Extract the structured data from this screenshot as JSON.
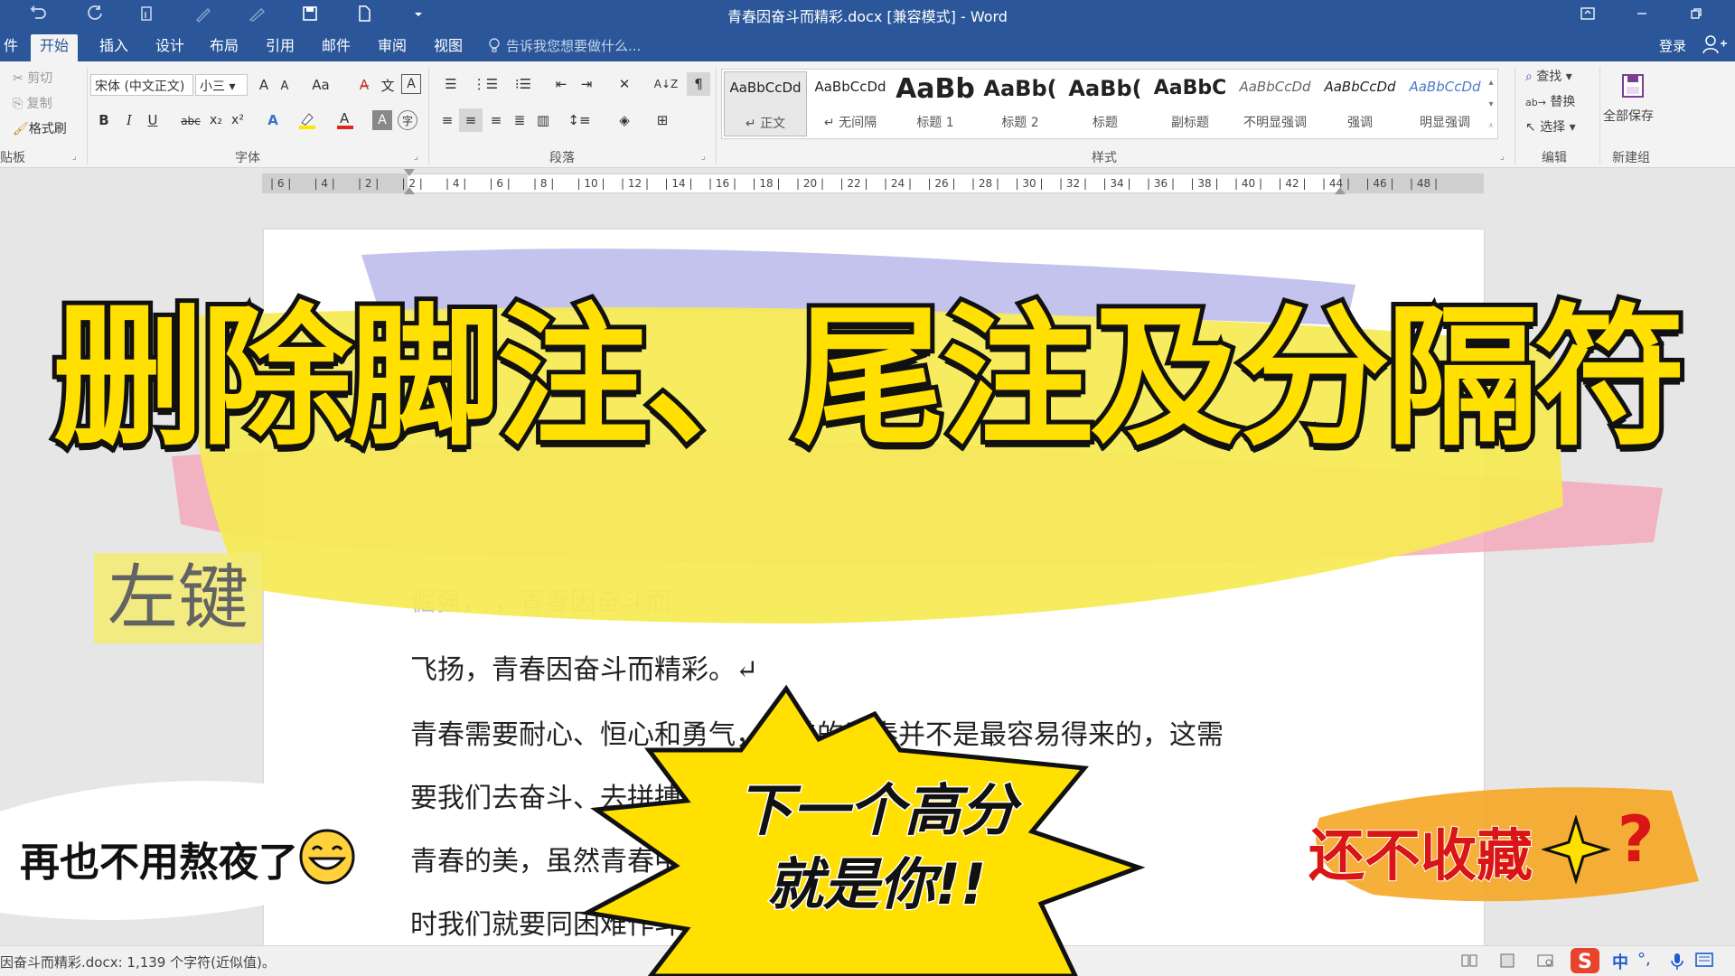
{
  "window": {
    "title": "青春因奋斗而精彩.docx [兼容模式] - Word"
  },
  "tabs": [
    {
      "label": "件"
    },
    {
      "label": "开始"
    },
    {
      "label": "插入"
    },
    {
      "label": "设计"
    },
    {
      "label": "布局"
    },
    {
      "label": "引用"
    },
    {
      "label": "邮件"
    },
    {
      "label": "审阅"
    },
    {
      "label": "视图"
    }
  ],
  "tell_me": "告诉我您想要做什么...",
  "account": {
    "login": "登录"
  },
  "ribbon": {
    "clipboard": {
      "cut": "剪切",
      "copy": "复制",
      "format_painter": "格式刷",
      "label": "贴板"
    },
    "font": {
      "family": "宋体 (中文正文)",
      "size": "小三",
      "grow": "A",
      "shrink": "A",
      "case": "Aa",
      "label": "字体",
      "bold": "B",
      "italic": "I",
      "underline": "U",
      "strike": "abc",
      "sub": "x₂",
      "sup": "x²"
    },
    "paragraph": {
      "label": "段落"
    },
    "styles": {
      "label": "样式",
      "items": [
        {
          "sample": "AaBbCcDd",
          "name": "↵ 正文"
        },
        {
          "sample": "AaBbCcDd",
          "name": "↵ 无间隔"
        },
        {
          "sample": "AaBb",
          "name": "标题 1"
        },
        {
          "sample": "AaBb(",
          "name": "标题 2"
        },
        {
          "sample": "AaBb(",
          "name": "标题"
        },
        {
          "sample": "AaBbC",
          "name": "副标题"
        },
        {
          "sample": "AaBbCcDd",
          "name": "不明显强调"
        },
        {
          "sample": "AaBbCcDd",
          "name": "强调"
        },
        {
          "sample": "AaBbCcDd",
          "name": "明显强调"
        }
      ]
    },
    "editing": {
      "find": "查找",
      "replace": "替换",
      "select": "选择",
      "label": "编辑"
    },
    "newgroup": {
      "save_all": "全部保存",
      "label": "新建组"
    }
  },
  "ruler": {
    "numbers": [
      "6",
      "4",
      "2",
      "2",
      "4",
      "6",
      "8",
      "10",
      "12",
      "14",
      "16",
      "18",
      "20",
      "22",
      "24",
      "26",
      "28",
      "30",
      "32",
      "34",
      "36",
      "38",
      "40",
      "42",
      "44",
      "46",
      "48"
    ]
  },
  "document": {
    "faded_line": "倔强，                                                  ，青春因奋斗而",
    "lines": [
      "飞扬，青春因奋斗而精彩。↵",
      "青春需要耐心、恒心和勇气，最美的青春并不是最容易得来的，这需",
      "要我们去奋斗、去拼搏，才能体会到青春的真正价值、",
      "青春的美，虽然青春中会有困难、更有退缩，",
      "时我们就要同困难作斗争，以青春已拼意志，去战胜"
    ]
  },
  "status": {
    "text": "因奋斗而精彩.docx: 1,139 个字符(近似值)。",
    "ime": "中"
  },
  "overlay": {
    "headline": "删除脚注、尾注及分隔符",
    "left_key": "左键",
    "burst_line1": "下一个高分",
    "burst_line2": "就是你!!",
    "never_again": "再也不用熬夜了",
    "collect": "还不收藏",
    "question": "?",
    "colors": {
      "yellow": "#ffe000",
      "red": "#d91515",
      "word_blue": "#2b579a"
    }
  }
}
